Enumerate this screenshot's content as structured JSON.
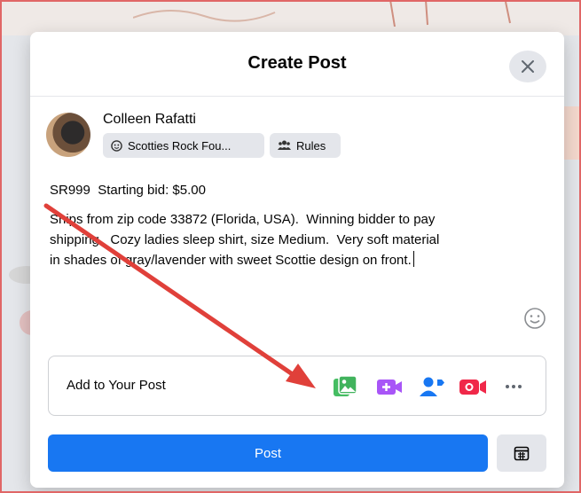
{
  "modal": {
    "title": "Create Post"
  },
  "author": {
    "name": "Colleen Rafatti",
    "group_chip": "Scotties Rock Fou...",
    "rules_chip": "Rules"
  },
  "post": {
    "line1": "SR999  Starting bid: $5.00",
    "body_lines": [
      "Ships from zip code 33872 (Florida, USA).  Winning bidder to pay",
      "shipping.  Cozy ladies sleep shirt, size Medium.  Very soft material",
      "in shades of gray/lavender with sweet Scottie design on front."
    ]
  },
  "add_to_post": {
    "label": "Add to Your Post",
    "icons": [
      "photo-video-icon",
      "gif-icon",
      "tag-people-icon",
      "live-video-icon",
      "more-icon"
    ]
  },
  "actions": {
    "post_label": "Post"
  },
  "colors": {
    "primary": "#1877f2",
    "photo": "#45bd62",
    "gif": "#a855f7",
    "tag": "#1877f2",
    "live": "#f02849",
    "annotation_arrow": "#e0403a"
  }
}
